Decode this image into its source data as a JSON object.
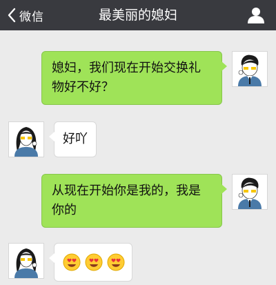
{
  "nav": {
    "back_label": "微信",
    "title": "最美丽的媳妇",
    "back_icon": "chevron-left-icon",
    "profile_icon": "person-icon"
  },
  "messages": [
    {
      "side": "right",
      "type": "text",
      "text": "媳妇，我们现在开始交换礼物好不好？",
      "avatar": "male-avatar"
    },
    {
      "side": "left",
      "type": "text",
      "text": "好吖",
      "avatar": "female-avatar"
    },
    {
      "side": "right",
      "type": "text",
      "text": "从现在开始你是我的，我是你的",
      "avatar": "male-avatar"
    },
    {
      "side": "left",
      "type": "emoji",
      "emojis": [
        "heart-eyes-emoji",
        "heart-eyes-emoji",
        "heart-eyes-emoji"
      ],
      "avatar": "female-avatar"
    }
  ],
  "colors": {
    "nav_bar": "#393a3f",
    "chat_background": "#ebebeb",
    "outgoing_bubble": "#9fe358",
    "incoming_bubble": "#ffffff"
  }
}
